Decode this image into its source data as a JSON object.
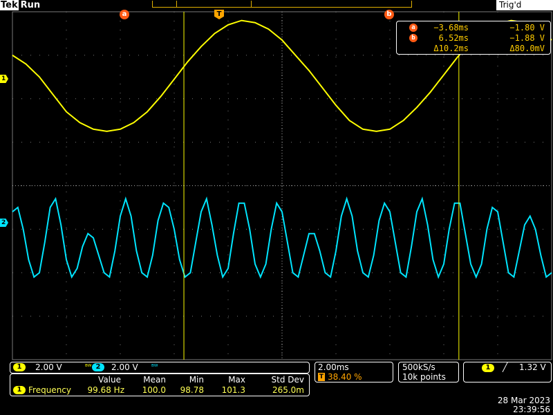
{
  "header": {
    "brand": "Tek",
    "run_state": "Run",
    "trigger_status": "Trig'd"
  },
  "markers": {
    "cursor_a": "a",
    "cursor_b": "b",
    "trigger": "T",
    "ch1": "1",
    "ch2": "2"
  },
  "cursor_readout": {
    "a_time": "−3.68ms",
    "a_value": "−1.80 V",
    "b_time": "6.52ms",
    "b_value": "−1.88 V",
    "delta_time": "Δ10.2ms",
    "delta_value": "Δ80.0mV"
  },
  "channels": [
    {
      "id": "1",
      "scale": "2.00 V",
      "bw_icon": "bandwidth-limit-icon",
      "bw_symbol": "ᴮᵂ",
      "color": "#ffff00"
    },
    {
      "id": "2",
      "scale": "2.00 V",
      "bw_icon": "bandwidth-limit-icon",
      "bw_symbol": "ᴮᵂ",
      "color": "#00e5ff"
    }
  ],
  "horizontal": {
    "timebase": "2.00ms",
    "trigger_tag": "T",
    "trigger_position": "38.40 %",
    "sample_rate": "500kS/s",
    "record_length": "10k points"
  },
  "trigger": {
    "source": "1",
    "slope_icon": "rising-edge-icon",
    "slope_symbol": "╱",
    "level": "1.32 V"
  },
  "measurements": {
    "headers": [
      "Value",
      "Mean",
      "Min",
      "Max",
      "Std Dev"
    ],
    "rows": [
      {
        "source": "1",
        "name": "Frequency",
        "value": "99.68 Hz",
        "mean": "100.0",
        "min": "98.78",
        "max": "101.3",
        "std_dev": "265.0m"
      }
    ]
  },
  "datetime": {
    "date": "28 Mar  2023",
    "time": "23:39:56"
  },
  "colors": {
    "ch1": "#ffff00",
    "ch2": "#00e5ff",
    "cursor": "#ff5a14",
    "trigger": "#ffa500",
    "grid": "#7a7a7a"
  },
  "chart_data": {
    "type": "line",
    "x_unit": "div",
    "xlim": [
      0,
      10
    ],
    "ylim": [
      -4,
      4
    ],
    "y_unit": "div",
    "series": [
      {
        "name": "",
        "color": "#ffff00",
        "sampled": {
          "x": [
            0.0,
            0.25,
            0.5,
            0.75,
            1.0,
            1.25,
            1.5,
            1.75,
            2.0,
            2.25,
            2.5,
            2.75,
            3.0,
            3.25,
            3.5,
            3.75,
            4.0,
            4.25,
            4.5,
            4.75,
            5.0,
            5.25,
            5.5,
            5.75,
            6.0,
            6.25,
            6.5,
            6.75,
            7.0,
            7.25,
            7.5,
            7.75,
            8.0,
            8.25,
            8.5,
            8.75,
            9.0,
            9.25,
            9.5,
            9.75,
            10.0
          ],
          "y": [
            3.0,
            2.8,
            2.5,
            2.1,
            1.7,
            1.45,
            1.3,
            1.25,
            1.3,
            1.45,
            1.7,
            2.05,
            2.45,
            2.85,
            3.2,
            3.5,
            3.7,
            3.8,
            3.75,
            3.6,
            3.35,
            3.0,
            2.65,
            2.25,
            1.85,
            1.5,
            1.3,
            1.25,
            1.3,
            1.5,
            1.8,
            2.15,
            2.55,
            2.95,
            3.3,
            3.55,
            3.72,
            3.8,
            3.75,
            3.6,
            3.35
          ]
        }
      },
      {
        "name": "",
        "color": "#00e5ff",
        "sampled": {
          "x": [
            0.0,
            0.1,
            0.2,
            0.3,
            0.4,
            0.5,
            0.6,
            0.7,
            0.8,
            0.9,
            1.0,
            1.1,
            1.2,
            1.3,
            1.4,
            1.5,
            1.6,
            1.7,
            1.8,
            1.9,
            2.0,
            2.1,
            2.2,
            2.3,
            2.4,
            2.5,
            2.6,
            2.7,
            2.8,
            2.9,
            3.0,
            3.1,
            3.2,
            3.3,
            3.4,
            3.5,
            3.6,
            3.7,
            3.8,
            3.9,
            4.0,
            4.1,
            4.2,
            4.3,
            4.4,
            4.5,
            4.6,
            4.7,
            4.8,
            4.9,
            5.0,
            5.1,
            5.2,
            5.3,
            5.4,
            5.5,
            5.6,
            5.7,
            5.8,
            5.9,
            6.0,
            6.1,
            6.2,
            6.3,
            6.4,
            6.5,
            6.6,
            6.7,
            6.8,
            6.9,
            7.0,
            7.1,
            7.2,
            7.3,
            7.4,
            7.5,
            7.6,
            7.7,
            7.8,
            7.9,
            8.0,
            8.1,
            8.2,
            8.3,
            8.4,
            8.5,
            8.6,
            8.7,
            8.8,
            8.9,
            9.0,
            9.1,
            9.2,
            9.3,
            9.4,
            9.5,
            9.6,
            9.7,
            9.8,
            9.9,
            10.0
          ],
          "y": [
            -0.6,
            -0.5,
            -1.0,
            -1.7,
            -2.1,
            -2.0,
            -1.3,
            -0.5,
            -0.3,
            -0.9,
            -1.7,
            -2.1,
            -1.9,
            -1.4,
            -1.1,
            -1.2,
            -1.6,
            -2.0,
            -2.1,
            -1.5,
            -0.7,
            -0.3,
            -0.7,
            -1.5,
            -2.0,
            -2.1,
            -1.6,
            -0.8,
            -0.4,
            -0.5,
            -1.0,
            -1.7,
            -2.1,
            -2.0,
            -1.3,
            -0.6,
            -0.3,
            -0.9,
            -1.6,
            -2.1,
            -1.9,
            -1.1,
            -0.4,
            -0.4,
            -1.0,
            -1.8,
            -2.1,
            -1.8,
            -1.0,
            -0.4,
            -0.6,
            -1.3,
            -2.0,
            -2.1,
            -1.6,
            -1.1,
            -1.1,
            -1.5,
            -2.0,
            -2.1,
            -1.5,
            -0.7,
            -0.3,
            -0.7,
            -1.5,
            -2.0,
            -2.1,
            -1.6,
            -0.8,
            -0.4,
            -0.6,
            -1.3,
            -2.0,
            -2.1,
            -1.4,
            -0.6,
            -0.3,
            -0.9,
            -1.7,
            -2.1,
            -1.8,
            -1.0,
            -0.4,
            -0.4,
            -1.1,
            -1.8,
            -2.1,
            -1.8,
            -1.0,
            -0.5,
            -0.6,
            -1.3,
            -2.0,
            -2.1,
            -1.5,
            -0.9,
            -0.7,
            -1.0,
            -1.6,
            -2.1,
            -2.0
          ]
        }
      }
    ],
    "cursors": {
      "a_div": 3.18,
      "b_div": 8.28
    },
    "trigger_div": 6.27
  }
}
